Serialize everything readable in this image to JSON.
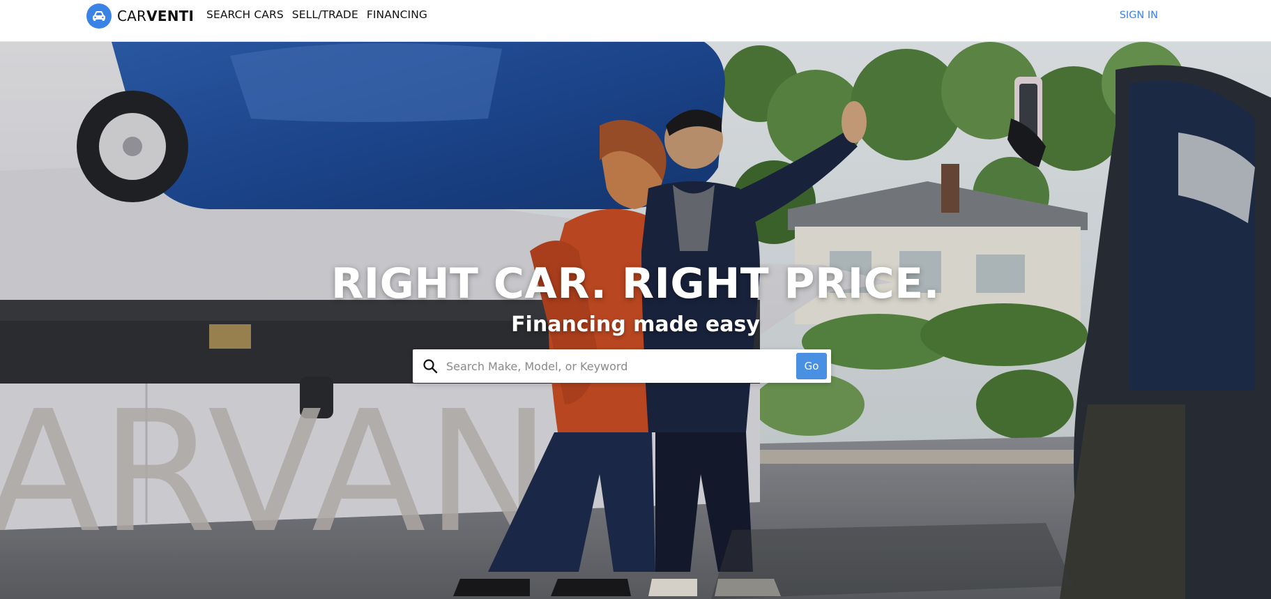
{
  "header": {
    "logo": {
      "icon": "car-icon",
      "text_light": "CAR",
      "text_bold": "VENTI",
      "badge_color": "#3b82e6"
    },
    "nav": [
      {
        "label": "SEARCH CARS"
      },
      {
        "label": "SELL/TRADE"
      },
      {
        "label": "FINANCING"
      }
    ],
    "sign_in_label": "SIGN IN",
    "accent_color": "#3b82e6"
  },
  "hero": {
    "background_image": "couple-posing-with-delivered-car-photo",
    "truck_lettering": "ARVAN",
    "headline": "RIGHT CAR. RIGHT PRICE.",
    "subheadline": "Financing made easy",
    "search": {
      "icon": "search-icon",
      "placeholder": "Search Make, Model, or Keyword",
      "value": "",
      "go_label": "Go",
      "go_color": "#4a90e2"
    }
  }
}
